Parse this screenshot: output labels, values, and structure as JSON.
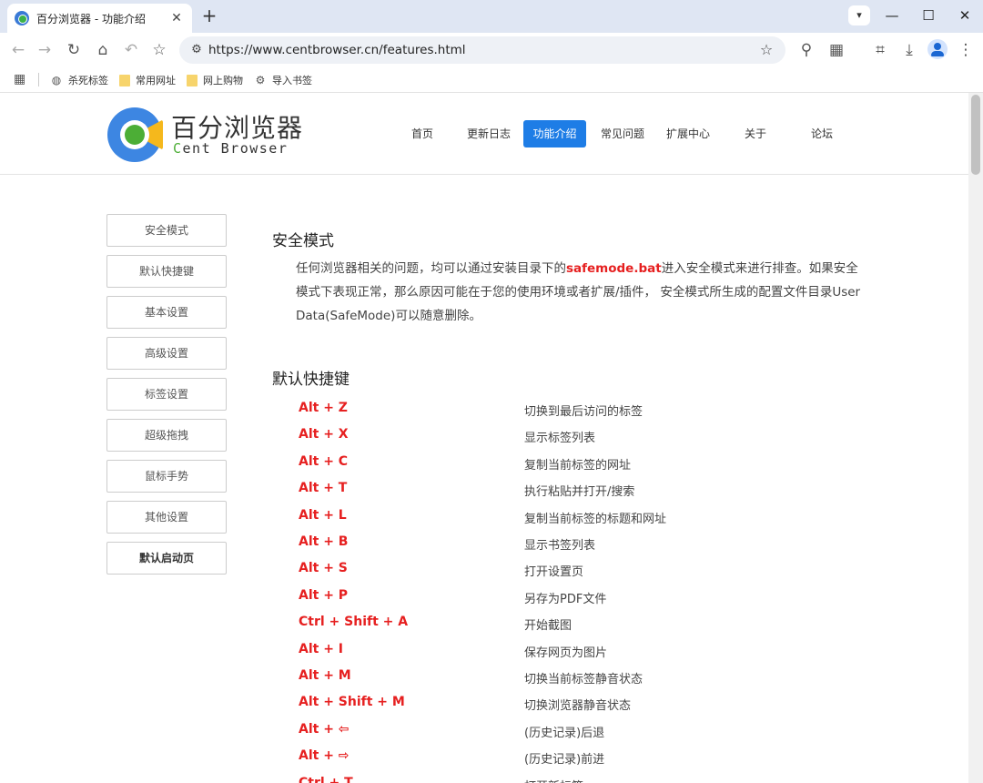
{
  "tab": {
    "title": "百分浏览器 - 功能介绍",
    "close": "✕"
  },
  "toolbar": {
    "url": "https://www.centbrowser.cn/features.html"
  },
  "bookmarks": [
    {
      "label": "杀死标签",
      "icon": "globe-icon"
    },
    {
      "label": "常用网址",
      "icon": "folder-icon"
    },
    {
      "label": "网上购物",
      "icon": "folder-icon"
    },
    {
      "label": "导入书签",
      "icon": "gear-icon"
    }
  ],
  "site": {
    "logo_cn": "百分浏览器",
    "logo_en_c": "C",
    "logo_en_rest": "ent Browser",
    "brand_colors": {
      "blue": "#3d86e2",
      "yellow": "#f5b81c",
      "green": "#4cae36"
    },
    "nav": [
      "首页",
      "更新日志",
      "功能介绍",
      "常见问题",
      "扩展中心",
      "关于",
      "论坛"
    ],
    "nav_active": "功能介绍"
  },
  "sidebar": [
    "安全模式",
    "默认快捷键",
    "基本设置",
    "高级设置",
    "标签设置",
    "超级拖拽",
    "鼠标手势",
    "其他设置",
    "默认启动页"
  ],
  "safe_mode": {
    "title": "安全模式",
    "text_1": "任何浏览器相关的问题，均可以通过安装目录下的",
    "highlight": "safemode.bat",
    "text_2": "进入安全模式来进行排查。如果安全模式下表现正常，那么原因可能在于您的使用环境或者扩展/插件， 安全模式所生成的配置文件目录User Data(SafeMode)可以随意删除。"
  },
  "shortcuts": {
    "title": "默认快捷键",
    "items": [
      {
        "key": "Alt + Z",
        "desc": "切换到最后访问的标签"
      },
      {
        "key": "Alt + X",
        "desc": "显示标签列表"
      },
      {
        "key": "Alt + C",
        "desc": "复制当前标签的网址"
      },
      {
        "key": "Alt + T",
        "desc": "执行粘贴并打开/搜索"
      },
      {
        "key": "Alt + L",
        "desc": "复制当前标签的标题和网址"
      },
      {
        "key": "Alt + B",
        "desc": "显示书签列表"
      },
      {
        "key": "Alt + S",
        "desc": "打开设置页"
      },
      {
        "key": "Alt + P",
        "desc": "另存为PDF文件"
      },
      {
        "key": "Ctrl + Shift + A",
        "desc": "开始截图"
      },
      {
        "key": "Alt + I",
        "desc": "保存网页为图片"
      },
      {
        "key": "Alt + M",
        "desc": "切换当前标签静音状态"
      },
      {
        "key": "Alt + Shift + M",
        "desc": "切换浏览器静音状态"
      },
      {
        "key": "Alt + ⇦",
        "desc": "(历史记录)后退"
      },
      {
        "key": "Alt + ⇨",
        "desc": "(历史记录)前进"
      },
      {
        "key": "Ctrl + T",
        "desc": "打开新标签"
      }
    ]
  }
}
